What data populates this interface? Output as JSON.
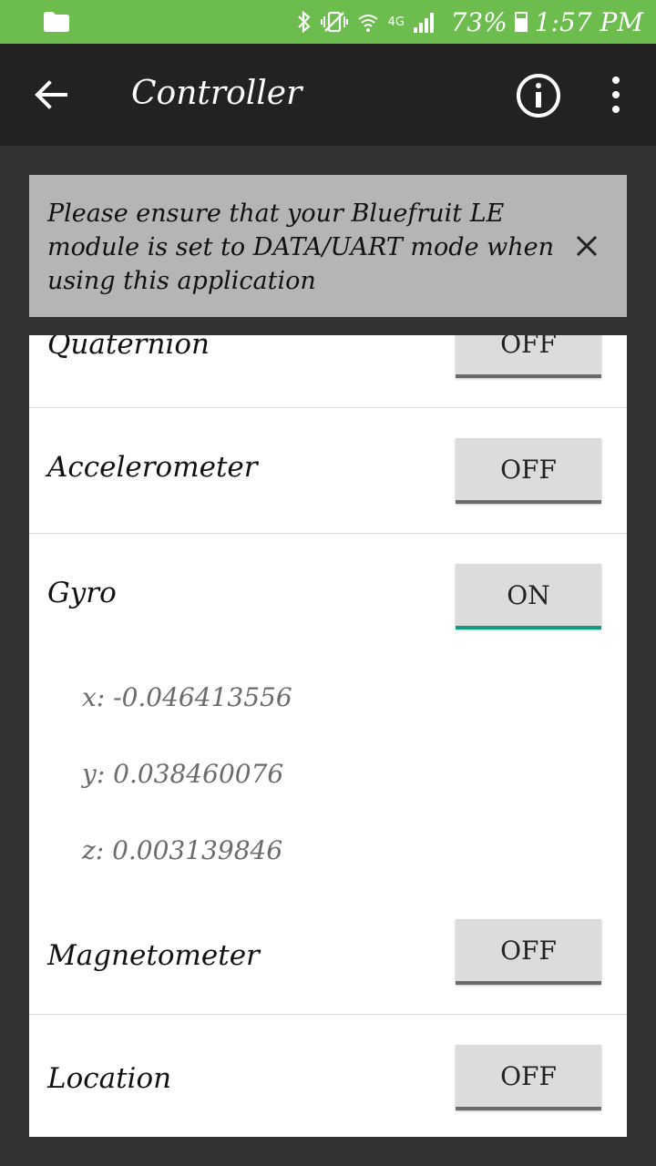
{
  "status_bar": {
    "network": "4G",
    "battery": "73%",
    "time": "1:57 PM",
    "bg_color": "#6cbc4e"
  },
  "app_bar": {
    "title": "Controller",
    "bg_color": "#222222"
  },
  "banner": {
    "message": "Please ensure that your Bluefruit LE module is set to DATA/UART mode when using this application"
  },
  "sensors": [
    {
      "label": "Quaternion",
      "state": "OFF"
    },
    {
      "label": "Accelerometer",
      "state": "OFF"
    },
    {
      "label": "Gyro",
      "state": "ON",
      "values": {
        "x": "x: -0.046413556",
        "y": "y: 0.038460076",
        "z": "z: 0.003139846"
      }
    },
    {
      "label": "Magnetometer",
      "state": "OFF"
    },
    {
      "label": "Location",
      "state": "OFF"
    }
  ],
  "colors": {
    "accent_on": "#149a82",
    "toggle_off_line": "#6b6b6b"
  }
}
